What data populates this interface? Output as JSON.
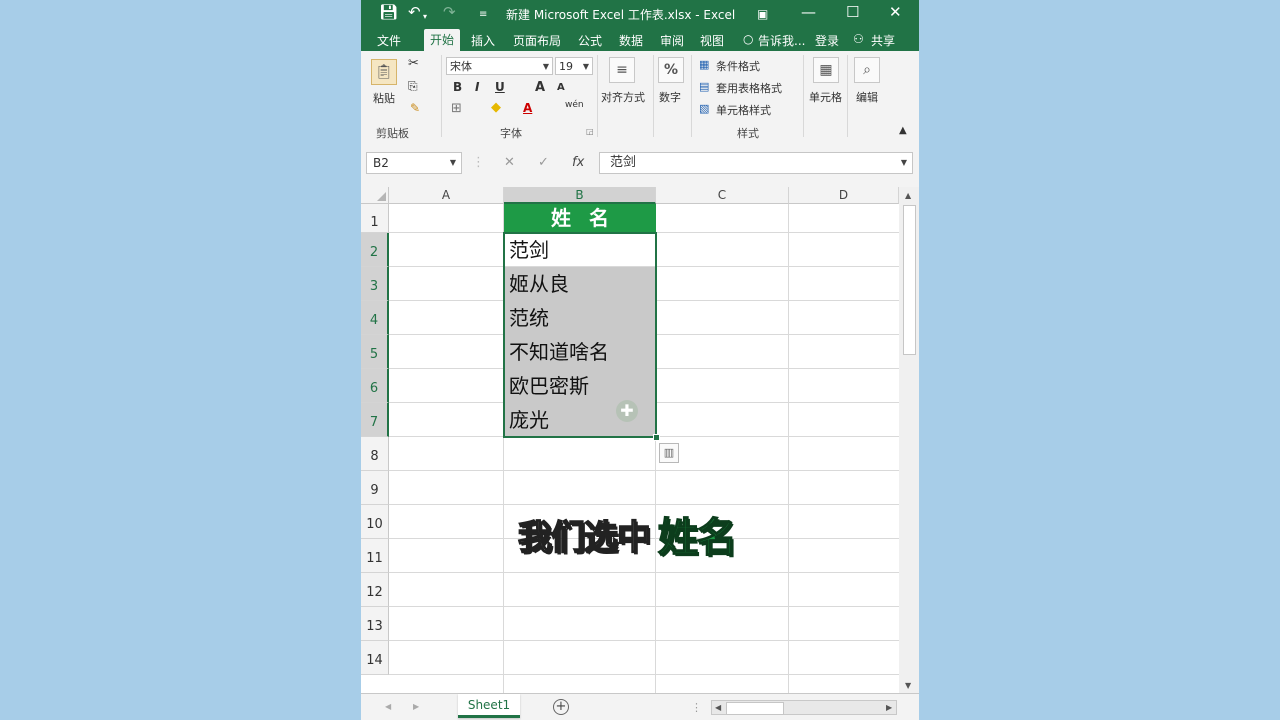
{
  "title_bar": {
    "save_icon": "save-icon",
    "undo_icon": "undo-icon",
    "redo_icon": "redo-icon",
    "customize_icon": "customize-quick-access-icon",
    "title": "新建 Microsoft Excel 工作表.xlsx - Excel",
    "ribbon_display_icon": "ribbon-display-icon",
    "minimize": "—",
    "maximize": "☐",
    "close": "✕"
  },
  "tabs": [
    {
      "label": "文件"
    },
    {
      "label": "开始"
    },
    {
      "label": "插入"
    },
    {
      "label": "页面布局"
    },
    {
      "label": "公式"
    },
    {
      "label": "数据"
    },
    {
      "label": "审阅"
    },
    {
      "label": "视图"
    },
    {
      "label": "告诉我..."
    },
    {
      "label": "登录"
    },
    {
      "label": "共享"
    }
  ],
  "ribbon": {
    "clipboard": {
      "paste": "粘贴",
      "group": "剪贴板"
    },
    "font": {
      "name": "宋体",
      "size": "19",
      "bold": "B",
      "italic": "I",
      "underline": "U",
      "grow": "A",
      "shrink": "A",
      "font_color": "A",
      "wen": "wén",
      "group": "字体"
    },
    "alignment": {
      "label": "对齐方式"
    },
    "number": {
      "label": "数字",
      "symbol": "%"
    },
    "styles": {
      "conditional": "条件格式",
      "table": "套用表格格式",
      "cell_styles": "单元格样式",
      "group": "样式"
    },
    "cells": {
      "label": "单元格"
    },
    "editing": {
      "label": "编辑"
    }
  },
  "formula_bar": {
    "name_box": "B2",
    "cancel": "✕",
    "enter": "✓",
    "fx": "fx",
    "value": "范剑"
  },
  "columns": [
    "A",
    "B",
    "C",
    "D"
  ],
  "rows": [
    "1",
    "2",
    "3",
    "4",
    "5",
    "6",
    "7",
    "8",
    "9",
    "10",
    "11",
    "12",
    "13",
    "14"
  ],
  "cells": {
    "B1": "姓名",
    "B2": "范剑",
    "B3": "姬从良",
    "B4": "范统",
    "B5": "不知道啥名",
    "B6": "欧巴密斯",
    "B7": "庞光"
  },
  "caption": {
    "white": "我们选中",
    "green": "姓名"
  },
  "sheets": [
    {
      "name": "Sheet1"
    }
  ],
  "colors": {
    "excel_green": "#217346",
    "header_fill": "#1e9a46",
    "background": "#a7cde8"
  }
}
